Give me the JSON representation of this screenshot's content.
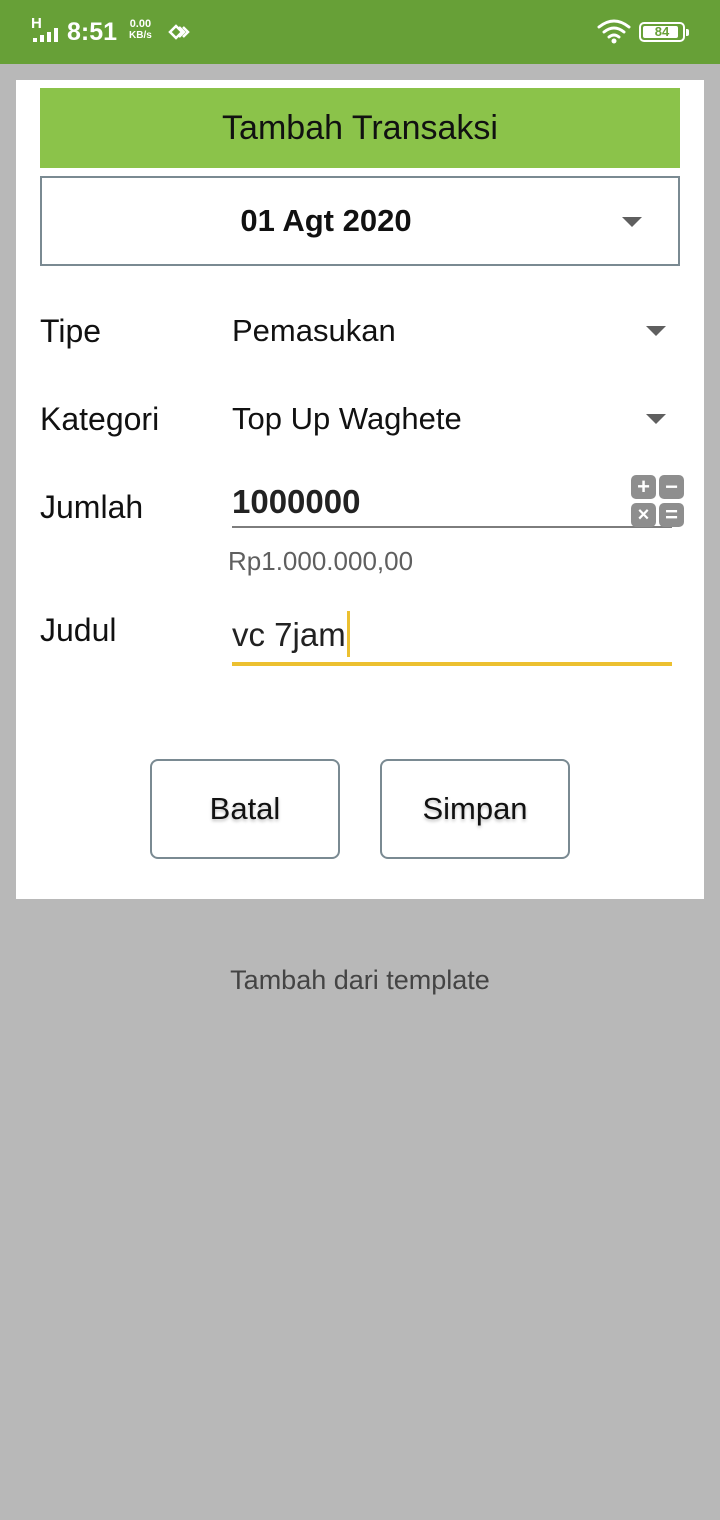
{
  "status_bar": {
    "network_type": "H",
    "time": "8:51",
    "net_speed_value": "0.00",
    "net_speed_unit": "KB/s",
    "battery_level": "84",
    "icons": [
      "signal-icon",
      "nfc-icon",
      "wifi-icon",
      "battery-icon"
    ]
  },
  "dialog": {
    "title": "Tambah Transaksi",
    "date": "01 Agt 2020",
    "fields": {
      "type_label": "Tipe",
      "type_value": "Pemasukan",
      "category_label": "Kategori",
      "category_value": "Top Up Waghete",
      "amount_label": "Jumlah",
      "amount_value": "1000000",
      "amount_formatted": "Rp1.000.000,00",
      "title_label": "Judul",
      "title_value": "vc 7jam"
    },
    "calculator_keys": [
      "+",
      "−",
      "×",
      "="
    ],
    "buttons": {
      "cancel": "Batal",
      "save": "Simpan"
    }
  },
  "template_link": "Tambah dari template",
  "colors": {
    "status_bar": "#67a037",
    "title_bar": "#8bc34a",
    "focus_underline": "#ecc030",
    "backdrop": "#b8b8b8"
  }
}
